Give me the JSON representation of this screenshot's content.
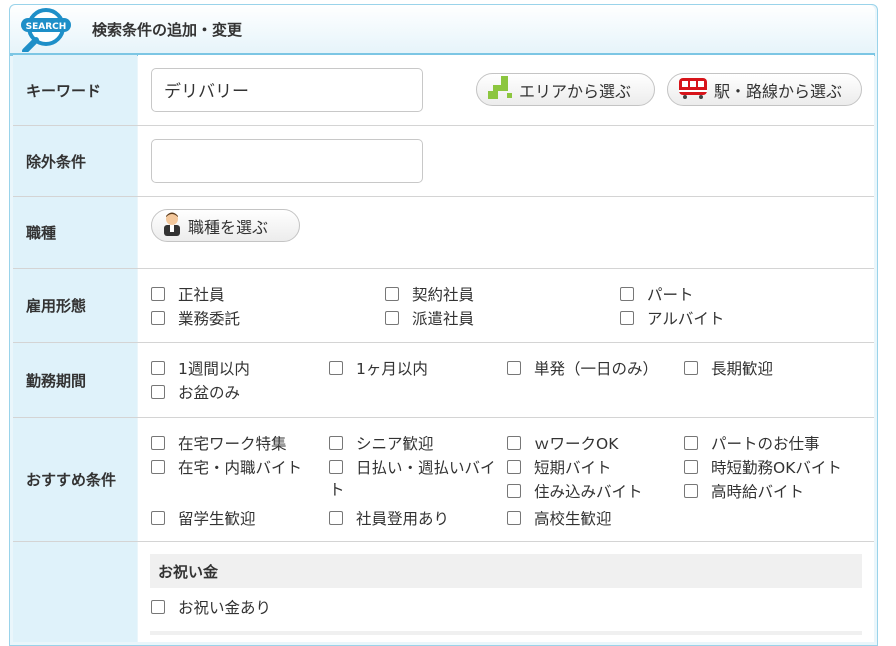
{
  "header": {
    "title": "検索条件の追加・変更",
    "logo_text": "SEARCH"
  },
  "keyword": {
    "label": "キーワード",
    "value": "デリバリー",
    "area_button": "エリアから選ぶ",
    "station_button": "駅・路線から選ぶ"
  },
  "exclude": {
    "label": "除外条件",
    "value": ""
  },
  "job_type": {
    "label": "職種",
    "button": "職種を選ぶ"
  },
  "employment": {
    "label": "雇用形態",
    "options": [
      "正社員",
      "契約社員",
      "パート",
      "業務委託",
      "派遣社員",
      "アルバイト"
    ]
  },
  "period": {
    "label": "勤務期間",
    "options": [
      "1週間以内",
      "1ヶ月以内",
      "単発（一日のみ）",
      "長期歓迎",
      "お盆のみ"
    ]
  },
  "recommended": {
    "label": "おすすめ条件",
    "options": [
      "在宅ワーク特集",
      "シニア歓迎",
      "ｗワークOK",
      "パートのお仕事",
      "在宅・内職バイト",
      "日払い・週払いバイト",
      "短期バイト",
      "時短勤務OKバイト",
      "住み込みバイト",
      "高時給バイト",
      "留学生歓迎",
      "社員登用あり",
      "高校生歓迎"
    ]
  },
  "bonus": {
    "heading": "お祝い金",
    "option": "お祝い金あり"
  },
  "colors": {
    "label_bg": "#dff2fa",
    "accent": "#7cc6e4",
    "logo_blue": "#1e8fc8"
  },
  "icons": [
    "search-logo-icon",
    "area-map-icon",
    "train-icon",
    "worker-icon"
  ]
}
